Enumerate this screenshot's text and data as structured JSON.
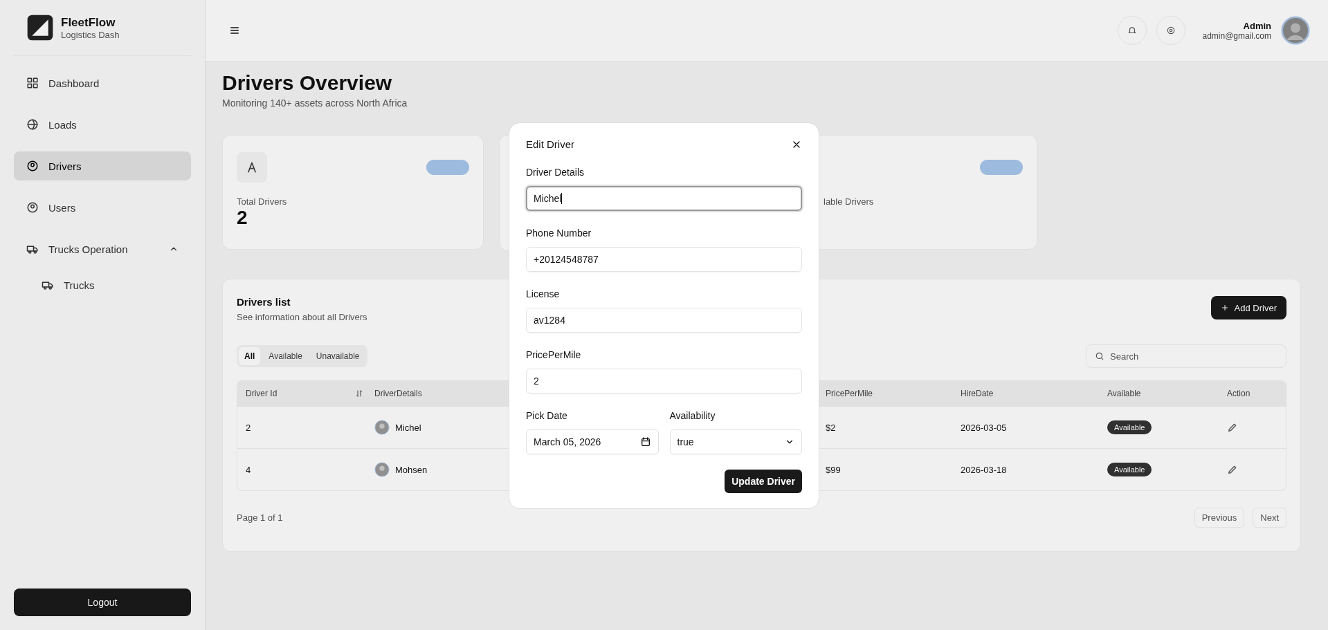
{
  "sidebar": {
    "brand": "FleetFlow",
    "tagline": "Logistics Dash",
    "items": [
      {
        "label": "Dashboard",
        "selected": false
      },
      {
        "label": "Loads",
        "selected": false
      },
      {
        "label": "Drivers",
        "selected": true
      },
      {
        "label": "Users",
        "selected": false
      },
      {
        "label": "Trucks Operation",
        "selected": false,
        "expanded": true,
        "children": [
          {
            "label": "Trucks",
            "selected": false
          }
        ]
      }
    ],
    "logout": "Logout"
  },
  "header": {
    "user_name": "Admin",
    "user_email": "admin@gmail.com"
  },
  "page": {
    "title": "Drivers Overview",
    "subtitle": "Monitoring 140+ assets across North Africa"
  },
  "stats": [
    {
      "label": "Total Drivers",
      "value": "2"
    },
    {
      "label": "lable Drivers"
    }
  ],
  "drivers_list": {
    "title": "Drivers list",
    "subtitle": "See information about all Drivers",
    "add_button": "Add Driver",
    "filters": [
      {
        "label": "All",
        "selected": true
      },
      {
        "label": "Available",
        "selected": false
      },
      {
        "label": "Unavailable",
        "selected": false
      }
    ],
    "search": {
      "placeholder": "Search"
    },
    "columns": [
      "Driver Id",
      "DriverDetails",
      "PricePerMile",
      "HireDate",
      "Available",
      "Action"
    ],
    "rows": [
      {
        "driver_id": "2",
        "name": "Michel",
        "price": "$2",
        "hire_date": "2026-03-05",
        "available": "Available"
      },
      {
        "driver_id": "4",
        "name": "Mohsen",
        "price": "$99",
        "hire_date": "2026-03-18",
        "available": "Available"
      }
    ],
    "page_info": "Page 1 of 1",
    "previous": "Previous",
    "next": "Next"
  },
  "dialog": {
    "title": "Edit Driver",
    "fields": [
      {
        "label": "Driver Details",
        "value": "Michel",
        "focused": true
      },
      {
        "label": "Phone Number",
        "value": "+20124548787",
        "focused": false
      },
      {
        "label": "License",
        "value": "av1284",
        "focused": false
      },
      {
        "label": "PricePerMile",
        "value": "2",
        "focused": false
      }
    ],
    "date": {
      "label": "Pick Date",
      "value": "March 05, 2026"
    },
    "availability": {
      "label": "Availability",
      "value": "true"
    },
    "submit": "Update Driver"
  }
}
